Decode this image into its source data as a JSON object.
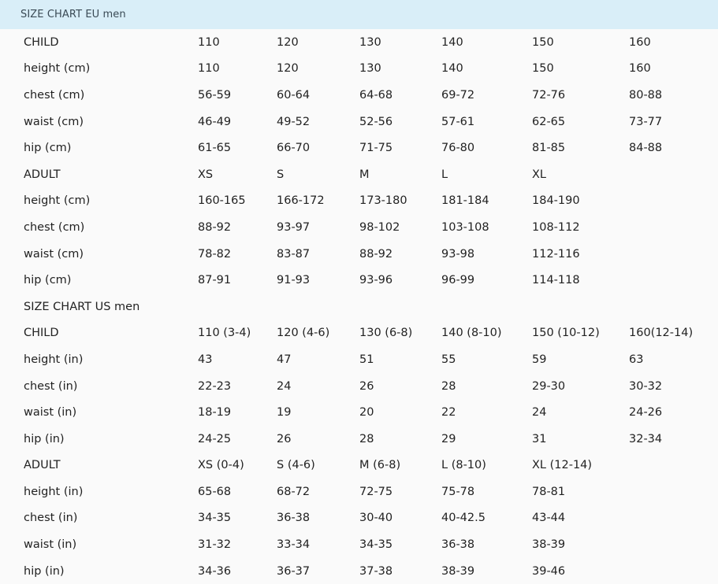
{
  "eu_title": "SIZE CHART EU men",
  "rows": [
    [
      "CHILD",
      "110",
      "120",
      "130",
      "140",
      "150",
      "160"
    ],
    [
      "height (cm)",
      "110",
      "120",
      "130",
      "140",
      "150",
      "160"
    ],
    [
      "chest (cm)",
      "56-59",
      "60-64",
      "64-68",
      "69-72",
      "72-76",
      "80-88"
    ],
    [
      "waist (cm)",
      "46-49",
      "49-52",
      "52-56",
      "57-61",
      "62-65",
      "73-77"
    ],
    [
      "hip (cm)",
      "61-65",
      "66-70",
      "71-75",
      "76-80",
      "81-85",
      "84-88"
    ],
    [
      "ADULT",
      "XS",
      "S",
      "M",
      "L",
      "XL",
      ""
    ],
    [
      "height (cm)",
      "160-165",
      "166-172",
      "173-180",
      "181-184",
      "184-190",
      ""
    ],
    [
      "chest (cm)",
      "88-92",
      "93-97",
      "98-102",
      "103-108",
      "108-112",
      ""
    ],
    [
      "waist (cm)",
      "78-82",
      "83-87",
      "88-92",
      "93-98",
      "112-116",
      ""
    ],
    [
      "hip (cm)",
      "87-91",
      "91-93",
      "93-96",
      "96-99",
      "114-118",
      ""
    ],
    [
      "SIZE CHART US men",
      "",
      "",
      "",
      "",
      "",
      ""
    ],
    [
      "CHILD",
      "110 (3-4)",
      "120 (4-6)",
      "130 (6-8)",
      "140 (8-10)",
      "150 (10-12)",
      "160(12-14)"
    ],
    [
      "height (in)",
      "43",
      "47",
      "51",
      "55",
      "59",
      "63"
    ],
    [
      "chest (in)",
      "22-23",
      "24",
      "26",
      "28",
      "29-30",
      "30-32"
    ],
    [
      "waist (in)",
      "18-19",
      "19",
      "20",
      "22",
      "24",
      "24-26"
    ],
    [
      "hip (in)",
      "24-25",
      "26",
      "28",
      "29",
      "31",
      "32-34"
    ],
    [
      "ADULT",
      "XS (0-4)",
      "S (4-6)",
      "M (6-8)",
      "L (8-10)",
      "XL (12-14)",
      ""
    ],
    [
      "height (in)",
      "65-68",
      "68-72",
      "72-75",
      "75-78",
      "78-81",
      ""
    ],
    [
      "chest (in)",
      "34-35",
      "36-38",
      "30-40",
      "40-42.5",
      "43-44",
      ""
    ],
    [
      "waist (in)",
      "31-32",
      "33-34",
      "34-35",
      "36-38",
      "38-39",
      ""
    ],
    [
      "hip (in)",
      "34-36",
      "36-37",
      "37-38",
      "38-39",
      "39-46",
      ""
    ]
  ]
}
